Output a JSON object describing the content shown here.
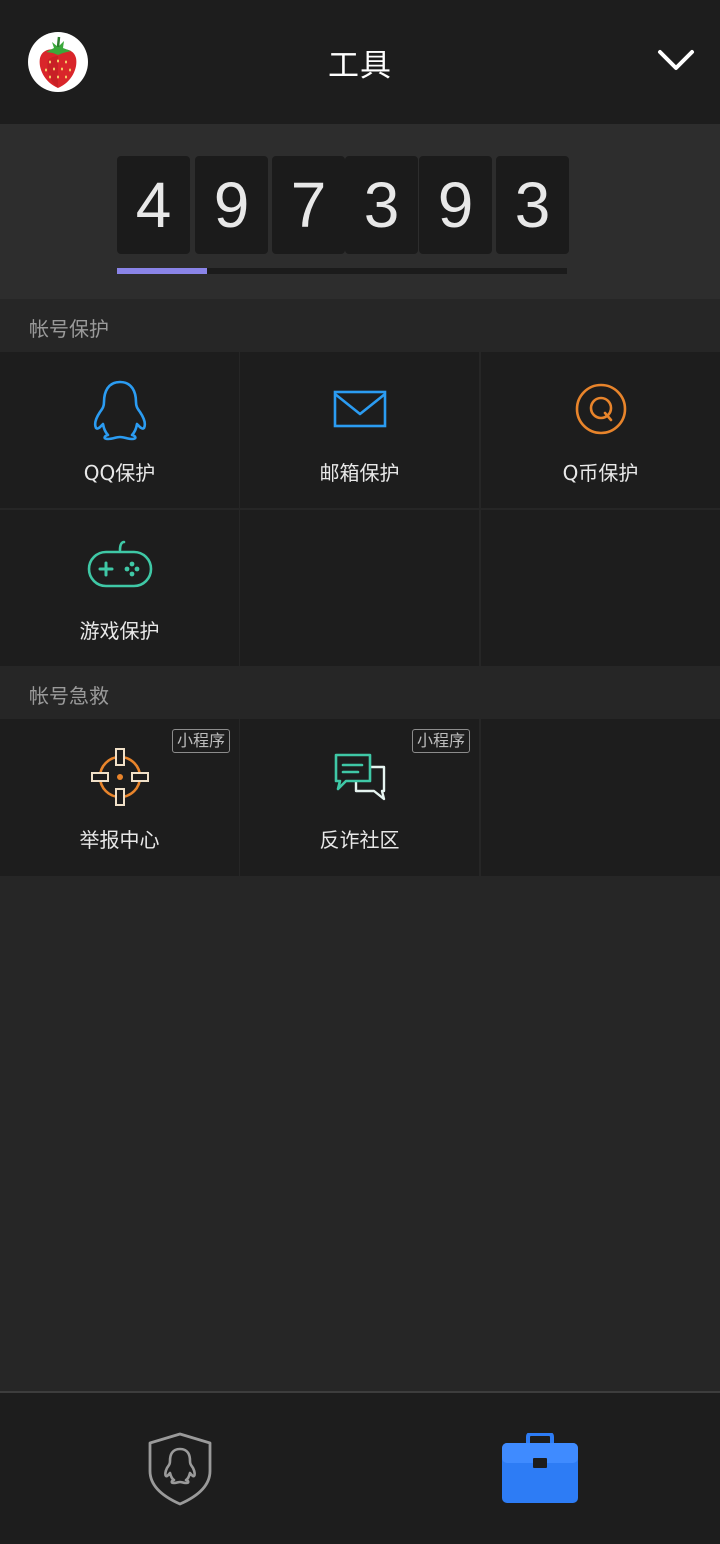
{
  "header": {
    "title": "工具",
    "avatar_icon": "strawberry-icon",
    "menu_icon": "chevron-down-icon"
  },
  "counter": {
    "digits": [
      "4",
      "9",
      "7",
      "3",
      "9",
      "3"
    ],
    "progress": 0.2,
    "progress_color": "#8a84e8"
  },
  "sections": {
    "account_protection": {
      "title": "帐号保护",
      "items": [
        {
          "label": "QQ保护",
          "icon": "penguin-icon",
          "color": "#2b9cf2"
        },
        {
          "label": "邮箱保护",
          "icon": "mail-icon",
          "color": "#2b9cf2"
        },
        {
          "label": "Q币保护",
          "icon": "q-coin-icon",
          "color": "#e8842b"
        },
        {
          "label": "游戏保护",
          "icon": "gamepad-icon",
          "color": "#3fc8a6"
        }
      ]
    },
    "account_rescue": {
      "title": "帐号急救",
      "items": [
        {
          "label": "举报中心",
          "icon": "crosshair-icon",
          "color": "#e8842b",
          "badge": "小程序"
        },
        {
          "label": "反诈社区",
          "icon": "chat-bubbles-icon",
          "color": "#3fc8a6",
          "badge": "小程序"
        }
      ]
    }
  },
  "bottom_nav": {
    "items": [
      {
        "icon": "penguin-shield-icon",
        "active": false
      },
      {
        "icon": "toolbox-icon",
        "active": true,
        "color": "#2d7cf5"
      }
    ]
  }
}
